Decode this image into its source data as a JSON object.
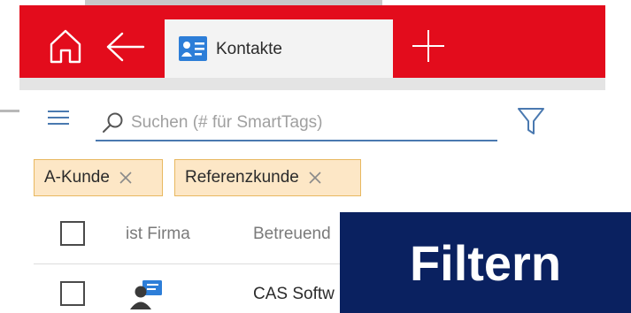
{
  "app": {
    "tab": {
      "label": "Kontakte"
    }
  },
  "search": {
    "placeholder": "Suchen (# für SmartTags)",
    "value": ""
  },
  "filter_chips": [
    {
      "label": "A-Kunde"
    },
    {
      "label": "Referenzkunde"
    }
  ],
  "table": {
    "columns": [
      "ist Firma",
      "Betreuend"
    ],
    "rows": [
      {
        "name": "CAS Softw"
      }
    ]
  },
  "overlay": {
    "label": "Filtern"
  },
  "colors": {
    "topbar": "#e30c1c",
    "tab_background": "#f3f3f3",
    "chip_background": "#fde7c6",
    "chip_border": "#e8b860",
    "search_underline": "#4a79b0",
    "overlay_background": "#0a2160"
  },
  "icons": [
    "home-icon",
    "arrow-left-icon",
    "contacts-card-icon",
    "plus-icon",
    "hamburger-menu-icon",
    "search-icon",
    "filter-funnel-icon",
    "close-icon",
    "checkbox-icon",
    "contact-person-icon"
  ]
}
